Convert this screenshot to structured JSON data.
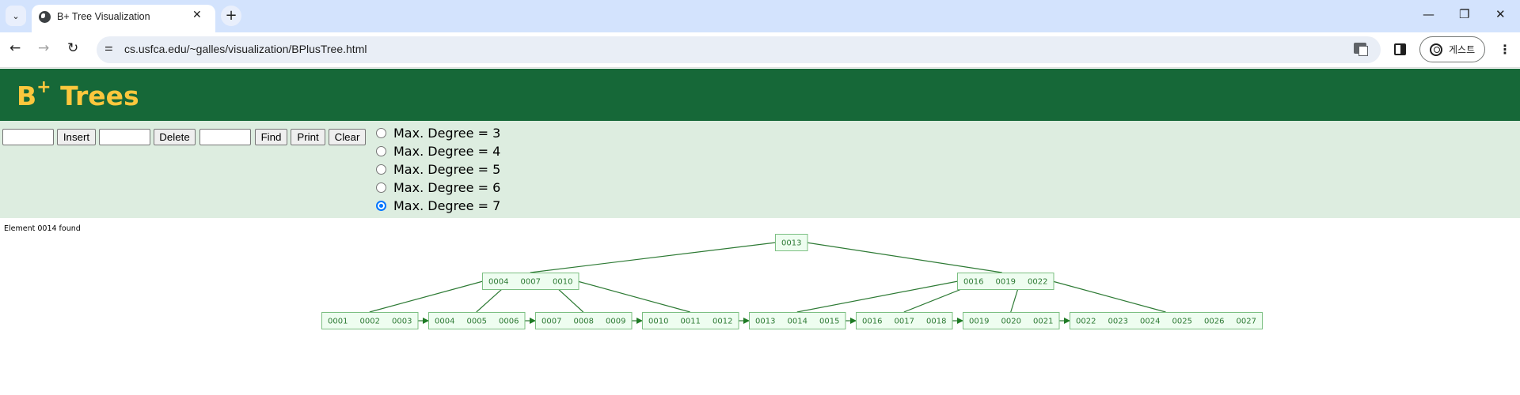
{
  "browser": {
    "tab_title": "B+ Tree Visualization",
    "url": "cs.usfca.edu/~galles/visualization/BPlusTree.html",
    "profile_label": "게스트",
    "icons": {
      "tab_list": "chevron-down-icon",
      "favicon": "globe-icon",
      "close": "close-icon",
      "new_tab": "plus-icon",
      "back": "arrow-left-icon",
      "forward": "arrow-right-icon",
      "reload": "reload-icon",
      "site_info": "tune-icon",
      "translate": "translate-icon",
      "side_panel": "side-panel-icon",
      "profile": "account-circle-icon",
      "menu": "kebab-menu-icon",
      "minimize": "minimize-icon",
      "restore": "restore-icon",
      "window_close": "close-icon"
    },
    "glyphs": {
      "tab_list": "⌄",
      "close": "✕",
      "new_tab": "+",
      "back": "←",
      "forward": "→",
      "reload": "↻",
      "site_info": "⚌",
      "menu": "⋮",
      "minimize": "—",
      "restore": "❐",
      "window_close": "✕"
    }
  },
  "page": {
    "title_main": "B",
    "title_sup": "+",
    "title_rest": " Trees",
    "colors": {
      "header_bg": "#166838",
      "title": "#fcc73d",
      "controls_bg": "#ddede0",
      "node_fill": "#eefdf0",
      "node_stroke": "#7cbf82",
      "edge": "#2d7a34",
      "radio_checked": "#0075ff"
    },
    "controls": {
      "insert_value": "",
      "insert_label": "Insert",
      "delete_value": "",
      "delete_label": "Delete",
      "find_value": "",
      "find_label": "Find",
      "print_label": "Print",
      "clear_label": "Clear"
    },
    "degree_options": [
      {
        "label": "Max. Degree = 3",
        "checked": false
      },
      {
        "label": "Max. Degree = 4",
        "checked": false
      },
      {
        "label": "Max. Degree = 5",
        "checked": false
      },
      {
        "label": "Max. Degree = 6",
        "checked": false
      },
      {
        "label": "Max. Degree = 7",
        "checked": true
      }
    ],
    "status": "Element 0014 found"
  },
  "tree": {
    "root": {
      "keys": [
        "0013"
      ]
    },
    "internal": [
      {
        "keys": [
          "0004",
          "0007",
          "0010"
        ]
      },
      {
        "keys": [
          "0016",
          "0019",
          "0022"
        ]
      }
    ],
    "leaves": [
      {
        "keys": [
          "0001",
          "0002",
          "0003"
        ]
      },
      {
        "keys": [
          "0004",
          "0005",
          "0006"
        ]
      },
      {
        "keys": [
          "0007",
          "0008",
          "0009"
        ]
      },
      {
        "keys": [
          "0010",
          "0011",
          "0012"
        ]
      },
      {
        "keys": [
          "0013",
          "0014",
          "0015"
        ]
      },
      {
        "keys": [
          "0016",
          "0017",
          "0018"
        ]
      },
      {
        "keys": [
          "0019",
          "0020",
          "0021"
        ]
      },
      {
        "keys": [
          "0022",
          "0023",
          "0024",
          "0025",
          "0026",
          "0027"
        ]
      }
    ]
  }
}
